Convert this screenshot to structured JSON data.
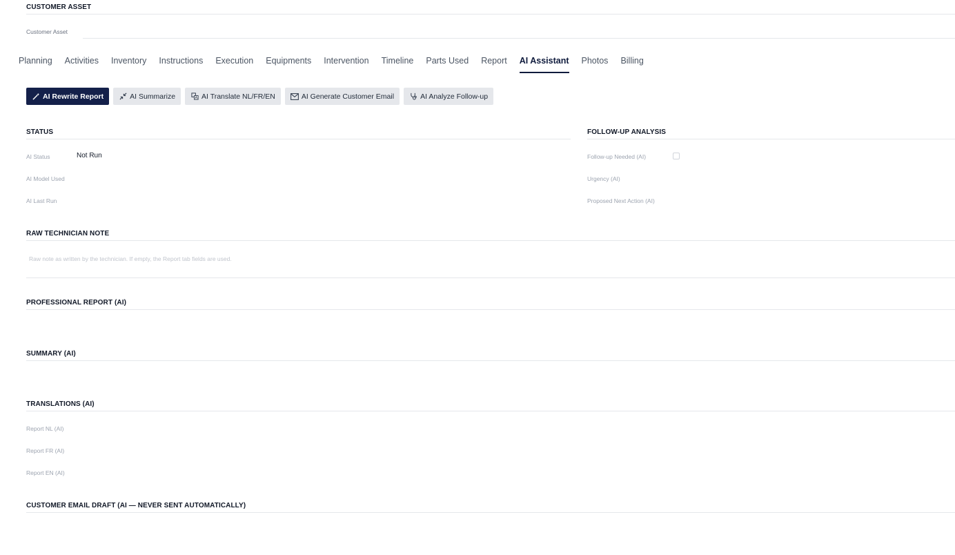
{
  "customer_asset": {
    "section_title": "CUSTOMER ASSET",
    "field_label": "Customer Asset"
  },
  "tabs": [
    {
      "label": "Planning"
    },
    {
      "label": "Activities"
    },
    {
      "label": "Inventory"
    },
    {
      "label": "Instructions"
    },
    {
      "label": "Execution"
    },
    {
      "label": "Equipments"
    },
    {
      "label": "Intervention"
    },
    {
      "label": "Timeline"
    },
    {
      "label": "Parts Used"
    },
    {
      "label": "Report"
    },
    {
      "label": "AI Assistant",
      "active": true
    },
    {
      "label": "Photos"
    },
    {
      "label": "Billing"
    }
  ],
  "actions": [
    {
      "label": "AI Rewrite Report",
      "icon": "wand-icon",
      "primary": true
    },
    {
      "label": "AI Summarize",
      "icon": "compress-icon"
    },
    {
      "label": "AI Translate NL/FR/EN",
      "icon": "translate-icon"
    },
    {
      "label": "AI Generate Customer Email",
      "icon": "envelope-icon"
    },
    {
      "label": "AI Analyze Follow-up",
      "icon": "stethoscope-icon"
    }
  ],
  "status": {
    "title": "STATUS",
    "ai_status_label": "AI Status",
    "ai_status_value": "Not Run",
    "ai_model_label": "AI Model Used",
    "ai_last_run_label": "AI Last Run"
  },
  "followup": {
    "title": "FOLLOW-UP ANALYSIS",
    "needed_label": "Follow-up Needed (AI)",
    "urgency_label": "Urgency (AI)",
    "next_action_label": "Proposed Next Action (AI)"
  },
  "raw_note": {
    "title": "RAW TECHNICIAN NOTE",
    "placeholder": "Raw note as written by the technician. If empty, the Report tab fields are used."
  },
  "professional_report": {
    "title": "PROFESSIONAL REPORT (AI)"
  },
  "summary": {
    "title": "SUMMARY (AI)"
  },
  "translations": {
    "title": "TRANSLATIONS (AI)",
    "nl_label": "Report NL (AI)",
    "fr_label": "Report FR (AI)",
    "en_label": "Report EN (AI)"
  },
  "email_draft": {
    "title": "CUSTOMER EMAIL DRAFT (AI — NEVER SENT AUTOMATICALLY)"
  },
  "colors": {
    "primary": "#14204a",
    "secondary_button": "#e5e7eb",
    "divider": "#e5e7eb",
    "muted_text": "#9ca3af"
  }
}
